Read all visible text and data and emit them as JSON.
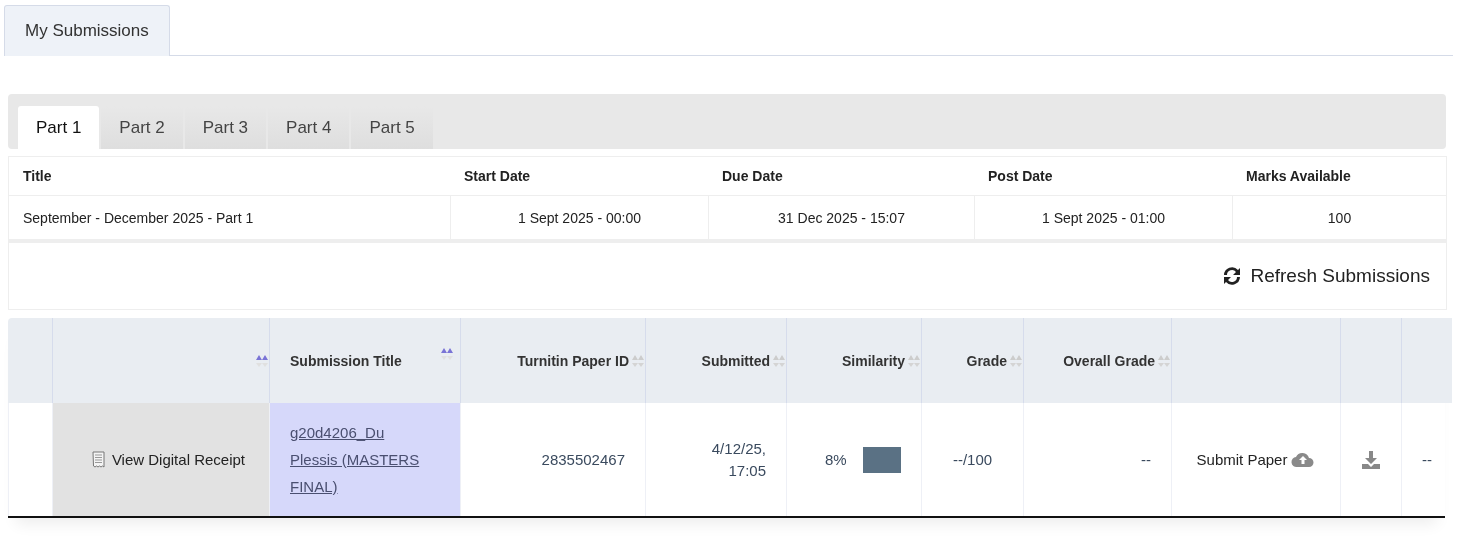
{
  "page_tabs": [
    {
      "label": "My Submissions",
      "selected": true
    }
  ],
  "part_tabs": [
    {
      "label": "Part 1",
      "selected": true
    },
    {
      "label": "Part 2",
      "selected": false
    },
    {
      "label": "Part 3",
      "selected": false
    },
    {
      "label": "Part 4",
      "selected": false
    },
    {
      "label": "Part 5",
      "selected": false
    }
  ],
  "assignment": {
    "columns": [
      "Title",
      "Start Date",
      "Due Date",
      "Post Date",
      "Marks Available"
    ],
    "row": [
      "September - December 2025 - Part 1",
      "1 Sept 2025 - 00:00",
      "31 Dec 2025 - 15:07",
      "1 Sept 2025 - 01:00",
      "100"
    ]
  },
  "refresh_button": {
    "label": "Refresh Submissions"
  },
  "submissions": {
    "columns": [
      {
        "kind": "blank"
      },
      {
        "kind": "sortable",
        "sorted": true
      },
      {
        "kind": "sortable",
        "label": "Submission Title",
        "sorted": true
      },
      {
        "kind": "sortable",
        "label": "Turnitin Paper ID",
        "sorted": false
      },
      {
        "kind": "sortable",
        "label": "Submitted",
        "sorted": false
      },
      {
        "kind": "sortable",
        "label": "Similarity",
        "sorted": false
      },
      {
        "kind": "sortable",
        "label": "Grade",
        "sorted": false
      },
      {
        "kind": "sortable",
        "label": "Overall Grade",
        "sorted": false
      },
      {
        "kind": "blank"
      },
      {
        "kind": "blank"
      },
      {
        "kind": "blank"
      }
    ],
    "rows": [
      {
        "receipt": "View Digital Receipt",
        "title": "g20d4206_Du Plessis (MASTERS FINAL)",
        "paper_id": "2835502467",
        "submitted": "4/12/25, 17:05",
        "similarity": "8%",
        "grade": "--/100",
        "overall_grade": "--",
        "submit": "Submit Paper",
        "last": "--"
      }
    ]
  }
}
